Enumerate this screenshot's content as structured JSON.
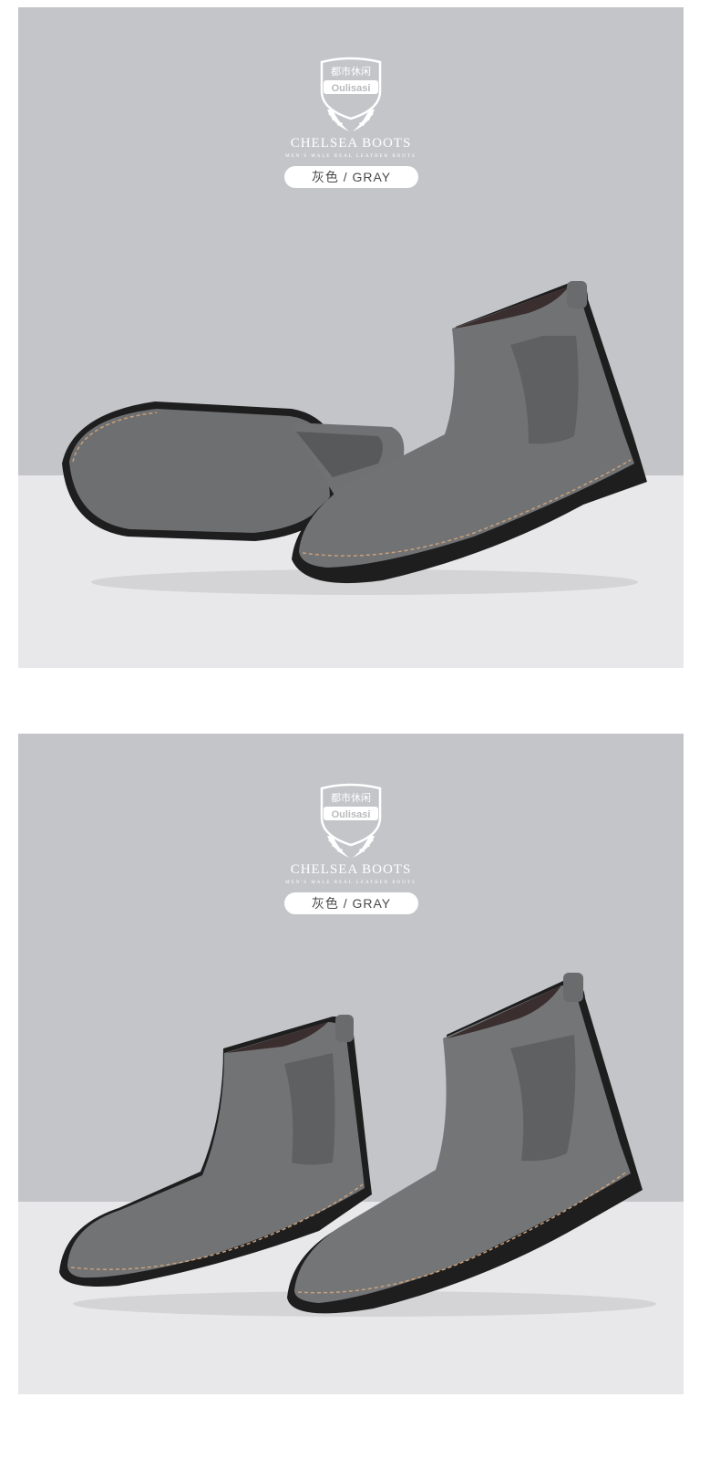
{
  "brand": {
    "crest_cn": "都市休闲",
    "crest_name": "Oulisasi",
    "title": "CHELSEA BOOTS",
    "subline": "MEN'S MALE REAL LEATHER BOOTS",
    "color_label": "灰色 / GRAY"
  },
  "colors": {
    "wall": "#c4c5c9",
    "floor": "#e8e8ea",
    "suede": "#6b6c6e",
    "sole": "#1e1e1f",
    "stitch": "#c9a07a"
  }
}
